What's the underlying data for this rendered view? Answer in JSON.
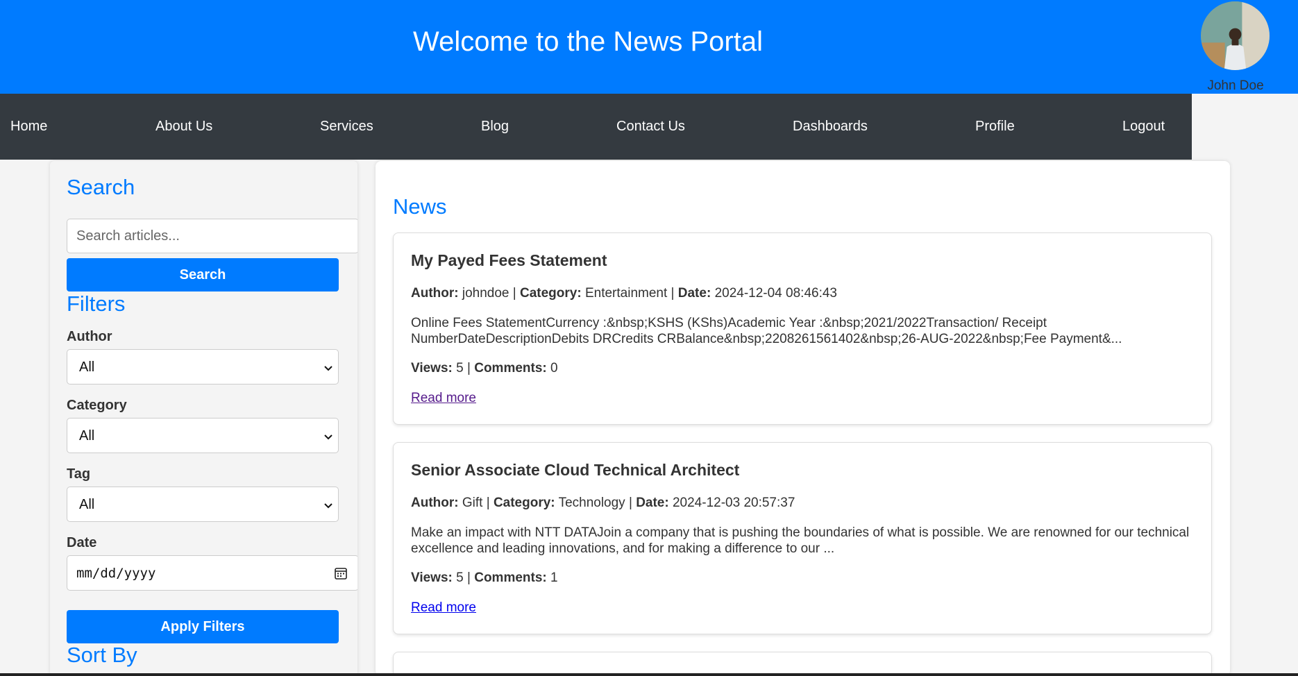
{
  "header": {
    "title": "Welcome to the News Portal",
    "user_name": "John Doe"
  },
  "nav": {
    "items": [
      "Home",
      "About Us",
      "Services",
      "Blog",
      "Contact Us",
      "Dashboards",
      "Profile",
      "Logout"
    ]
  },
  "sidebar": {
    "search_heading": "Search",
    "search_placeholder": "Search articles...",
    "search_button": "Search",
    "filters_heading": "Filters",
    "author_label": "Author",
    "author_value": "All",
    "category_label": "Category",
    "category_value": "All",
    "tag_label": "Tag",
    "tag_value": "All",
    "date_label": "Date",
    "date_value": "mm/dd/yyyy",
    "apply_button": "Apply Filters",
    "sort_heading": "Sort By"
  },
  "main": {
    "heading": "News",
    "labels": {
      "author": "Author:",
      "category": "Category:",
      "date": "Date:",
      "views": "Views:",
      "comments": "Comments:",
      "sep": " | "
    },
    "articles": [
      {
        "title": "My Payed Fees Statement",
        "author": "johndoe",
        "category": "Entertainment",
        "date": "2024-12-04 08:46:43",
        "excerpt": "Online Fees StatementCurrency :&nbsp;KSHS (KShs)Academic Year :&nbsp;2021/2022Transaction/ Receipt NumberDateDescriptionDebits DRCredits CRBalance&nbsp;2208261561402&nbsp;26-AUG-2022&nbsp;Fee Payment&...",
        "views": "5",
        "comments": "0",
        "read_more": "Read more",
        "link_color": "#551a8b"
      },
      {
        "title": "Senior Associate Cloud Technical Architect",
        "author": "Gift",
        "category": "Technology",
        "date": "2024-12-03 20:57:37",
        "excerpt": "Make an impact with NTT DATAJoin a company that is pushing the boundaries of what is possible. We are renowned for our technical excellence and leading innovations, and for making a difference to our ...",
        "views": "5",
        "comments": "1",
        "read_more": "Read more",
        "link_color": "#0000ee"
      }
    ]
  },
  "colors": {
    "primary": "#007bff",
    "nav_bg": "#343a40"
  }
}
